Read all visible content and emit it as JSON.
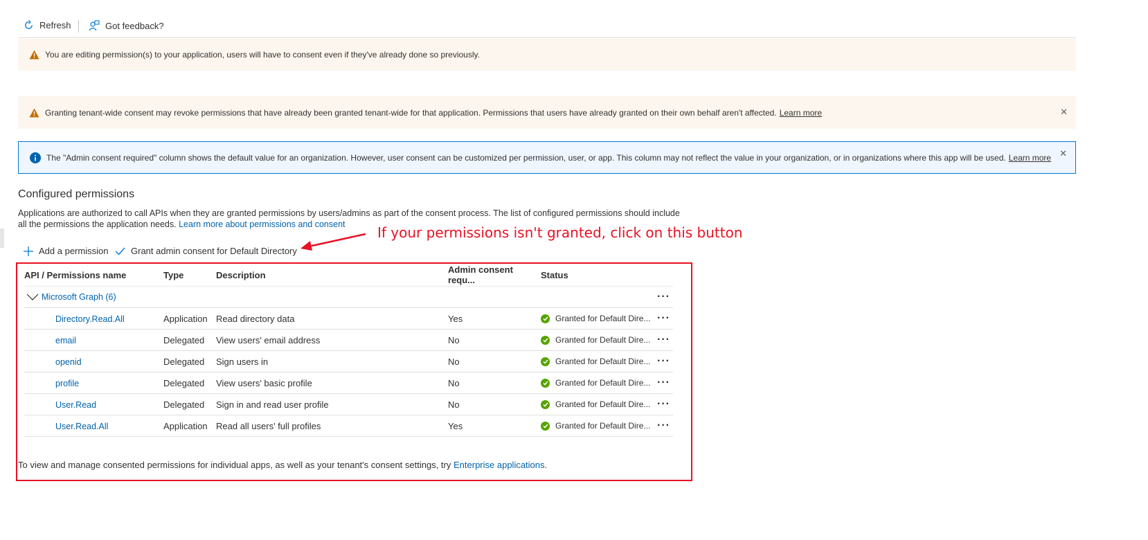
{
  "toolbar": {
    "refresh_label": "Refresh",
    "feedback_label": "Got feedback?"
  },
  "banners": {
    "editing_warning": "You are editing permission(s) to your application, users will have to consent even if they've already done so previously.",
    "tenant_warning": "Granting tenant-wide consent may revoke permissions that have already been granted tenant-wide for that application. Permissions that users have already granted on their own behalf aren't affected.",
    "tenant_learn_more": "Learn more",
    "info_text": "The \"Admin consent required\" column shows the default value for an organization. However, user consent can be customized per permission, user, or app. This column may not reflect the value in your organization, or in organizations where this app will be used.",
    "info_learn_more": "Learn more"
  },
  "section": {
    "title": "Configured permissions",
    "desc_line1": "Applications are authorized to call APIs when they are granted permissions by users/admins as part of the consent process. The list of configured permissions should include",
    "desc_line2": "all the permissions the application needs.",
    "desc_link": "Learn more about permissions and consent"
  },
  "commands": {
    "add_permission": "Add a permission",
    "grant_consent": "Grant admin consent for Default Directory"
  },
  "annotation": "If your permissions isn't granted, click on this button",
  "table": {
    "columns": [
      "API / Permissions name",
      "Type",
      "Description",
      "Admin consent requ...",
      "Status"
    ],
    "group_label": "Microsoft Graph (6)",
    "rows": [
      {
        "name": "Directory.Read.All",
        "type": "Application",
        "description": "Read directory data",
        "admin": "Yes",
        "status": "Granted for Default Dire..."
      },
      {
        "name": "email",
        "type": "Delegated",
        "description": "View users' email address",
        "admin": "No",
        "status": "Granted for Default Dire..."
      },
      {
        "name": "openid",
        "type": "Delegated",
        "description": "Sign users in",
        "admin": "No",
        "status": "Granted for Default Dire..."
      },
      {
        "name": "profile",
        "type": "Delegated",
        "description": "View users' basic profile",
        "admin": "No",
        "status": "Granted for Default Dire..."
      },
      {
        "name": "User.Read",
        "type": "Delegated",
        "description": "Sign in and read user profile",
        "admin": "No",
        "status": "Granted for Default Dire..."
      },
      {
        "name": "User.Read.All",
        "type": "Application",
        "description": "Read all users' full profiles",
        "admin": "Yes",
        "status": "Granted for Default Dire..."
      }
    ]
  },
  "footer": {
    "text": "To view and manage consented permissions for individual apps, as well as your tenant's consent settings, try",
    "link": "Enterprise applications",
    "period": "."
  },
  "colors": {
    "link": "#0062ad",
    "annotation_red": "#e81123",
    "warning_bg": "#fdf6ee",
    "info_border": "#0078d4",
    "granted_green": "#57a300"
  },
  "icons": {
    "refresh": "refresh-icon",
    "feedback": "feedback-icon",
    "warning": "warning-icon",
    "info": "info-icon",
    "close": "close-icon",
    "add": "plus-icon",
    "check": "checkmark-icon",
    "chevron": "chevron-down-icon",
    "granted": "granted-check-icon",
    "more": "more-icon"
  }
}
